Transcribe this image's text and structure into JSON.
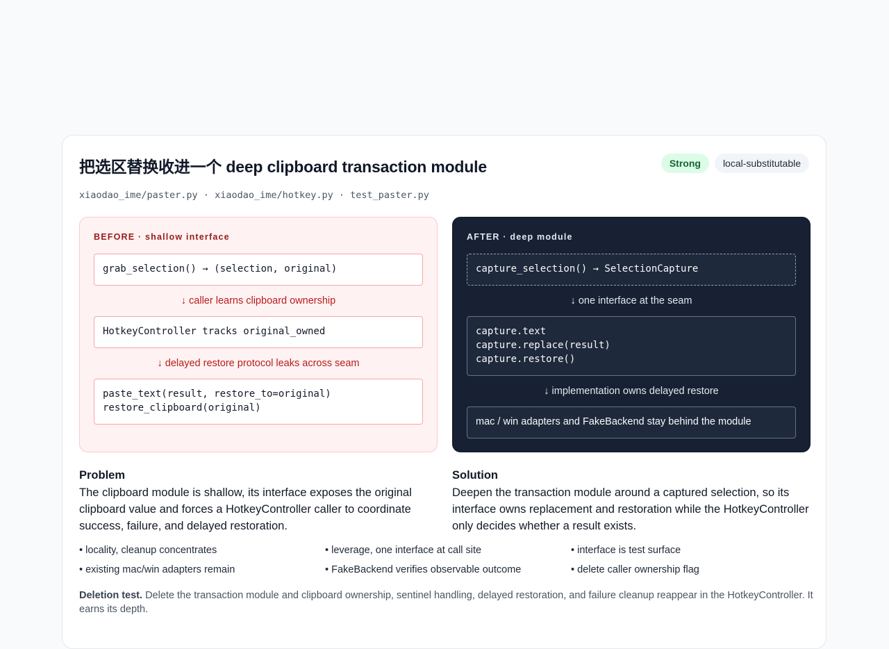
{
  "header": {
    "title": "把选区替换收进一个 deep clipboard transaction module",
    "badge_strength": "Strong",
    "badge_tag": "local-substitutable",
    "files": "xiaodao_ime/paster.py · xiaodao_ime/hotkey.py · test_paster.py"
  },
  "before": {
    "label": "BEFORE · shallow interface",
    "box1": "grab_selection() → (selection, original)",
    "arrow1": "↓ caller learns clipboard ownership",
    "box2": "HotkeyController tracks original_owned",
    "arrow2": "↓ delayed restore protocol leaks across seam",
    "box3": "paste_text(result, restore_to=original)\nrestore_clipboard(original)"
  },
  "after": {
    "label": "AFTER · deep module",
    "box1": "capture_selection() → SelectionCapture",
    "arrow1": "↓ one interface at the seam",
    "box2": "capture.text\ncapture.replace(result)\ncapture.restore()",
    "arrow2": "↓ implementation owns delayed restore",
    "box3": "mac / win adapters and FakeBackend stay behind the module"
  },
  "problem": {
    "heading": "Problem",
    "text": "The clipboard module is shallow, its interface exposes the original clipboard value and forces a HotkeyController caller to coordinate success, failure, and delayed restoration."
  },
  "solution": {
    "heading": "Solution",
    "text": "Deepen the transaction module around a captured selection, so its interface owns replacement and restoration while the HotkeyController only decides whether a result exists."
  },
  "bullets": [
    "• locality, cleanup concentrates",
    "• leverage, one interface at call site",
    "• interface is test surface",
    "• existing mac/win adapters remain",
    "• FakeBackend verifies observable outcome",
    "• delete caller ownership flag"
  ],
  "deletion": {
    "label": "Deletion test.",
    "text": "Delete the transaction module and clipboard ownership, sentinel handling, delayed restoration, and failure cleanup reappear in the HotkeyController. It earns its depth."
  },
  "colors": {
    "page_bg": "#f9fafb",
    "before_bg": "#fef2f2",
    "before_accent": "#b91c1c",
    "after_bg": "#182033",
    "strong_badge_bg": "#dcfce7",
    "strong_badge_fg": "#166534"
  }
}
